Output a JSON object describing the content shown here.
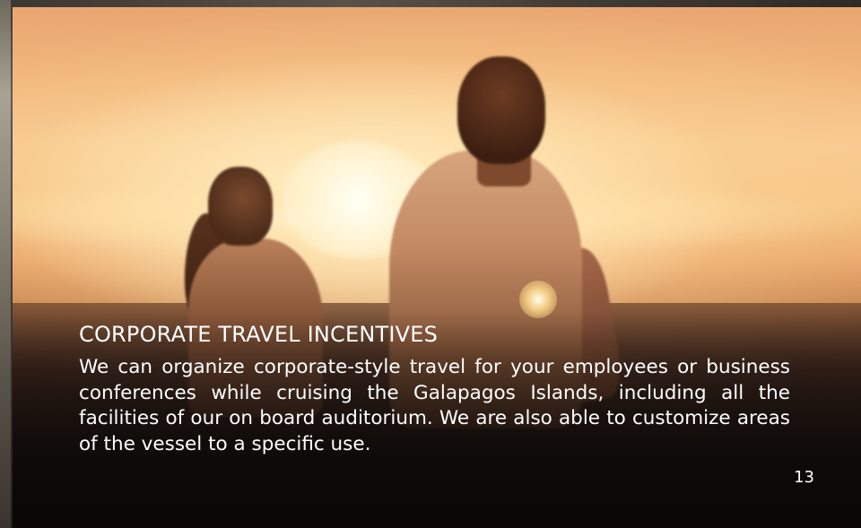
{
  "page": {
    "title": "CORPORATE TRAVEL INCENTIVES",
    "body": "We can organize corporate-style travel for your employees or business conferences while cruising the Galapagos Islands, including all the facilities of our on board auditorium. We are also able to customize areas of the vessel to a specific use.",
    "page_number": "13",
    "background_photo": "sunset-couple-photo"
  },
  "colors": {
    "text": "#ffffff",
    "sky_warm": "#f3c283",
    "shadow": "#150f0c"
  }
}
